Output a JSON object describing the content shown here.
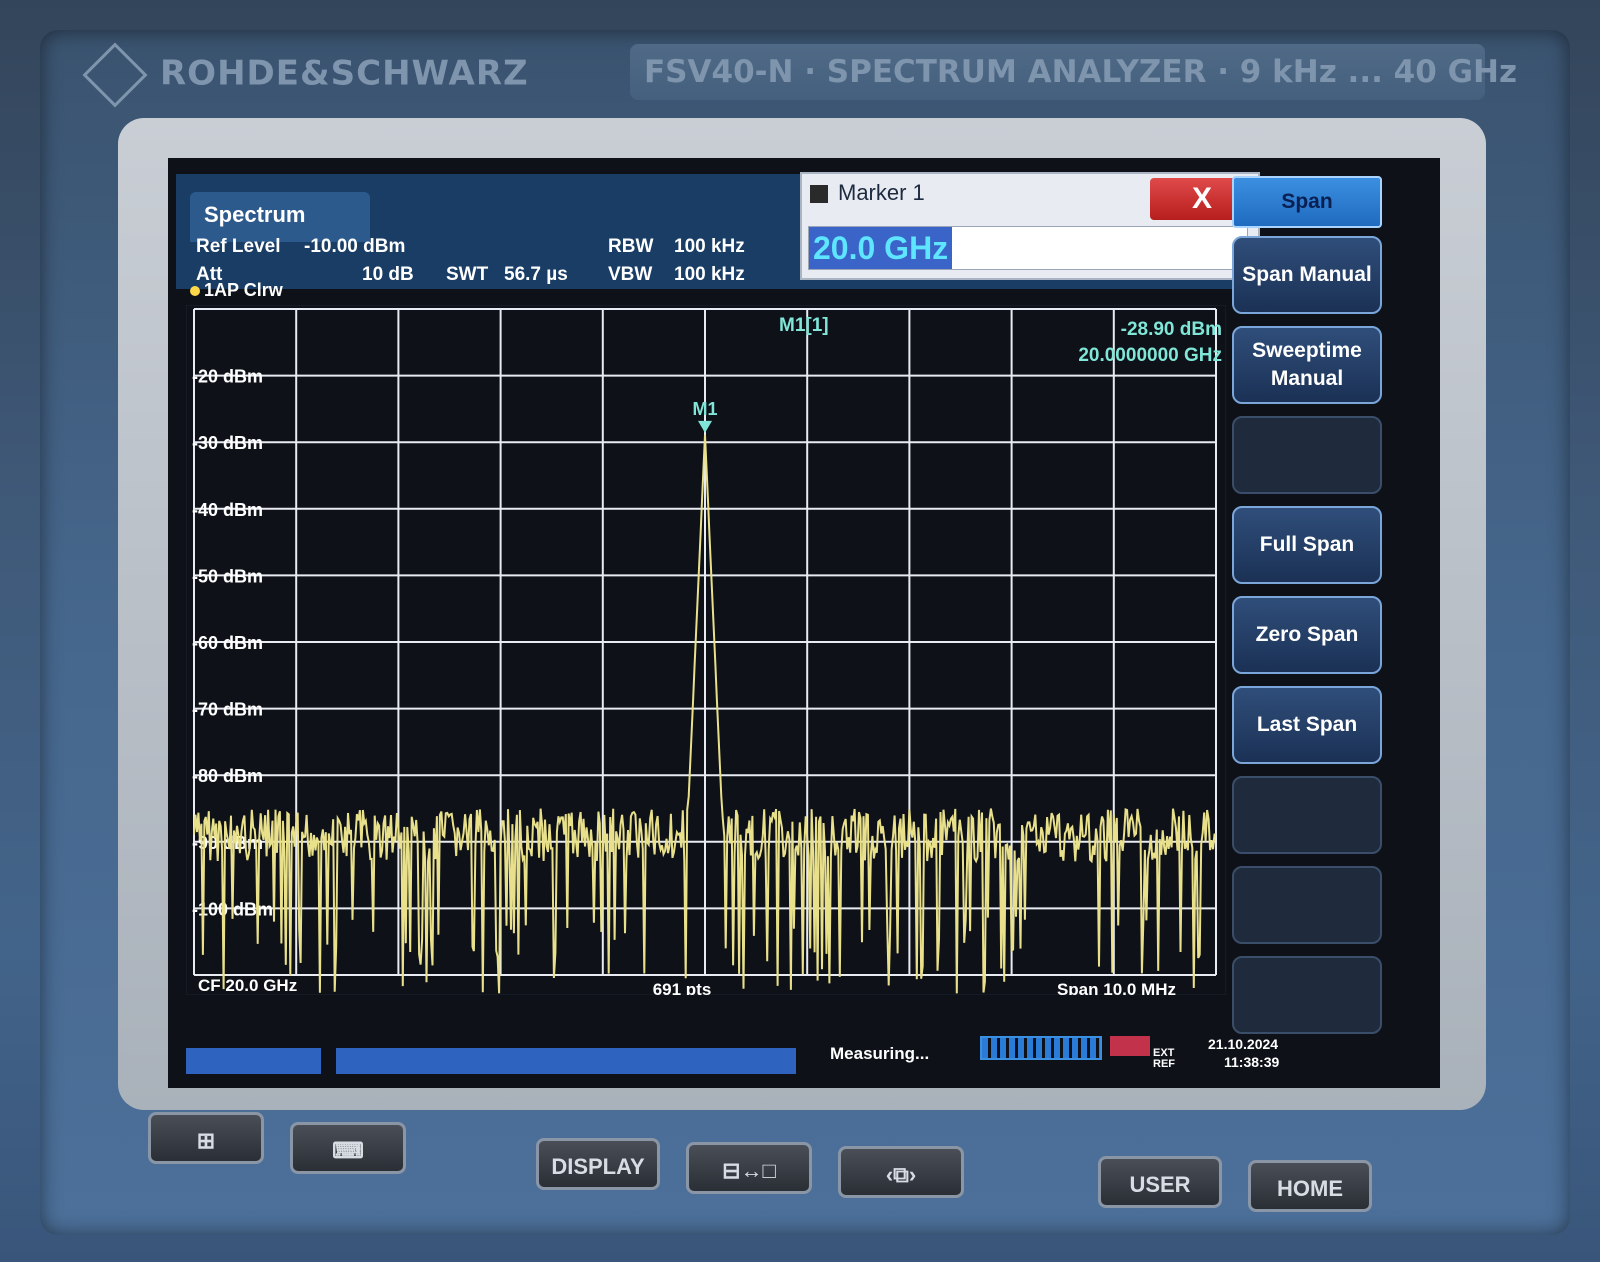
{
  "device": {
    "brand": "ROHDE&SCHWARZ",
    "model": "FSV40-N · SPECTRUM ANALYZER · 9 kHz ... 40 GHz"
  },
  "header": {
    "tab": "Spectrum",
    "ref_level_label": "Ref Level",
    "ref_level_value": "-10.00 dBm",
    "att_label": "Att",
    "att_value": "10 dB",
    "swt_label": "SWT",
    "swt_value": "56.7 µs",
    "rbw_label": "RBW",
    "rbw_value": "100 kHz",
    "vbw_label": "VBW",
    "vbw_value": "100 kHz",
    "trace_label": "1AP Clrw"
  },
  "marker_dialog": {
    "title": "Marker 1",
    "close": "X",
    "input_value": "20.0 GHz"
  },
  "softkeys": {
    "header": "Span",
    "keys": [
      "Span Manual",
      "Sweeptime Manual",
      "",
      "Full Span",
      "Zero Span",
      "Last Span",
      "",
      "",
      ""
    ]
  },
  "marker_readout": {
    "name": "M1[1]",
    "level": "-28.90 dBm",
    "freq": "20.0000000 GHz",
    "label": "M1"
  },
  "footer": {
    "cf": "CF 20.0 GHz",
    "pts": "691 pts",
    "span": "Span 10.0 MHz",
    "measuring": "Measuring...",
    "ext_ref": "EXT REF",
    "date": "21.10.2024",
    "time": "11:38:39"
  },
  "hardware_buttons": [
    "DISPLAY",
    "USER",
    "HOME"
  ],
  "chart_data": {
    "type": "line",
    "x_axis": {
      "center_ghz": 20.0,
      "span_mhz": 10.0,
      "points": 691
    },
    "y_axis_labels": [
      "-20 dBm",
      "-30 dBm",
      "-40 dBm",
      "-50 dBm",
      "-60 dBm",
      "-70 dBm",
      "-80 dBm",
      "-90 dBm",
      "-100 dBm"
    ],
    "ylim": [
      -110,
      -10
    ],
    "grid": true,
    "series": [
      {
        "peak": {
          "x_offset_mhz": 0.0,
          "level_dbm": -28.9
        },
        "noise_floor_dbm": [
          -85,
          -95
        ]
      }
    ],
    "trace_color": "#e8e08a",
    "grid_color": "#e8ecf2",
    "marker_color": "#7fe6d8"
  }
}
